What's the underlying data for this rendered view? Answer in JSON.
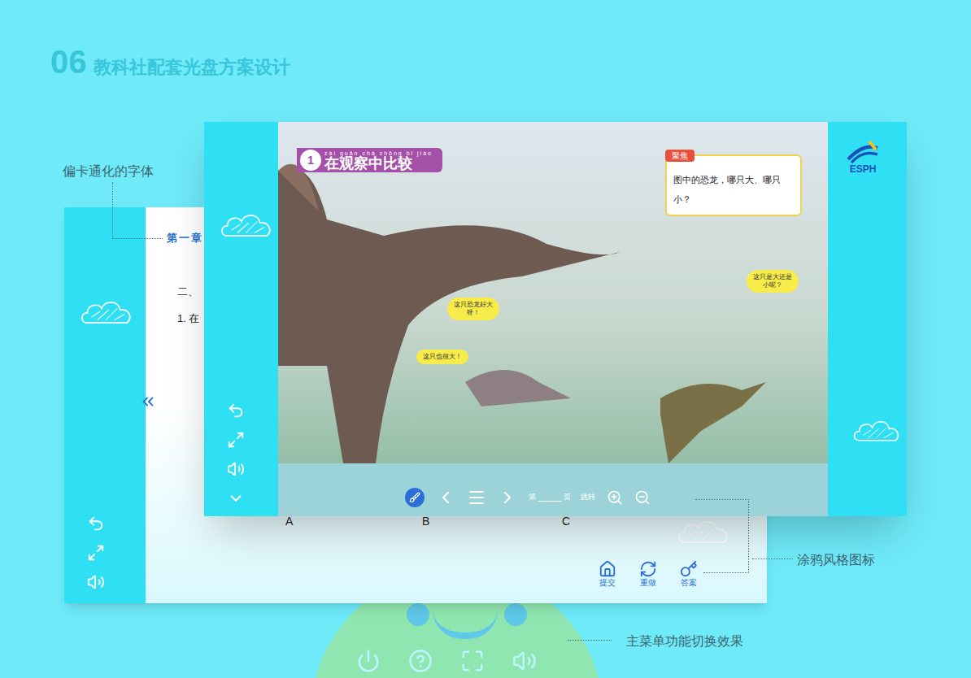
{
  "slide": {
    "number": "06",
    "title": "教科社配套光盘方案设计"
  },
  "annotations": [
    {
      "text": "偏卡通化的字体"
    },
    {
      "text": "涂鸦风格图标"
    },
    {
      "text": "主菜单功能切换效果"
    }
  ],
  "back_window": {
    "chapter": "第一章",
    "lines": [
      "二、",
      "1. 在"
    ],
    "options": [
      "A",
      "B",
      "C"
    ],
    "buttons": [
      {
        "label": "提交"
      },
      {
        "label": "重做"
      },
      {
        "label": "答案"
      }
    ]
  },
  "front_window": {
    "logo": "ESPH",
    "lesson": {
      "number": "1",
      "pinyin": "zài guān chá zhōng bǐ jiào",
      "title": "在观察中比较"
    },
    "focus": {
      "label": "聚焦",
      "question": "图中的恐龙，哪只大、哪只小？"
    },
    "bubbles": [
      {
        "text": "这只恐龙好大呀！"
      },
      {
        "text": "这只也很大！"
      },
      {
        "text": "这只是大还是小呢？"
      }
    ],
    "toolbar": {
      "page_prefix": "第",
      "page_suffix": "页",
      "jump": "跳转"
    }
  }
}
